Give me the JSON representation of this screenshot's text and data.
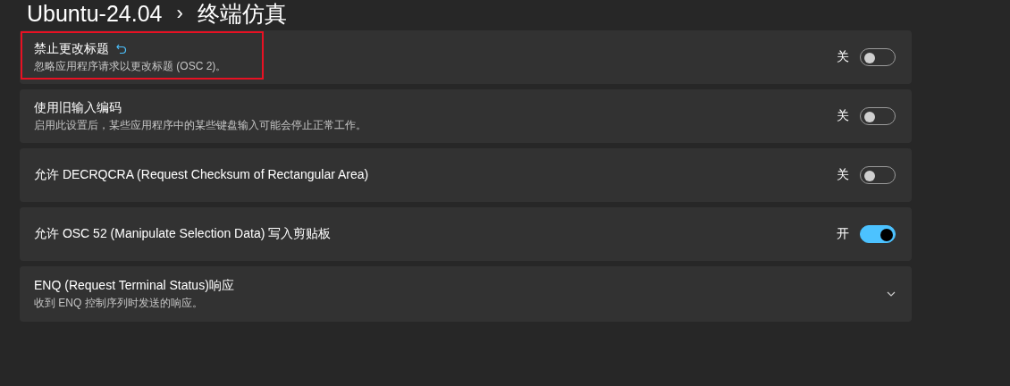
{
  "breadcrumb": {
    "parent": "Ubuntu-24.04",
    "separator": "›",
    "current": "终端仿真"
  },
  "settings": [
    {
      "kind": "toggle",
      "title": "禁止更改标题",
      "description": "忽略应用程序请求以更改标题 (OSC 2)。",
      "modified": true,
      "highlighted": true,
      "state_label": "关",
      "on": false
    },
    {
      "kind": "toggle",
      "title": "使用旧输入编码",
      "description": "启用此设置后，某些应用程序中的某些键盘输入可能会停止正常工作。",
      "modified": false,
      "highlighted": false,
      "state_label": "关",
      "on": false
    },
    {
      "kind": "toggle",
      "title": "允许 DECRQCRA (Request Checksum of Rectangular Area)",
      "modified": false,
      "highlighted": false,
      "state_label": "关",
      "on": false
    },
    {
      "kind": "toggle",
      "title": "允许 OSC 52 (Manipulate Selection Data) 写入剪贴板",
      "modified": false,
      "highlighted": false,
      "state_label": "开",
      "on": true
    },
    {
      "kind": "expander",
      "title": "ENQ (Request Terminal Status)响应",
      "description": "收到 ENQ 控制序列时发送的响应。",
      "modified": false,
      "highlighted": false,
      "expanded": false
    }
  ]
}
